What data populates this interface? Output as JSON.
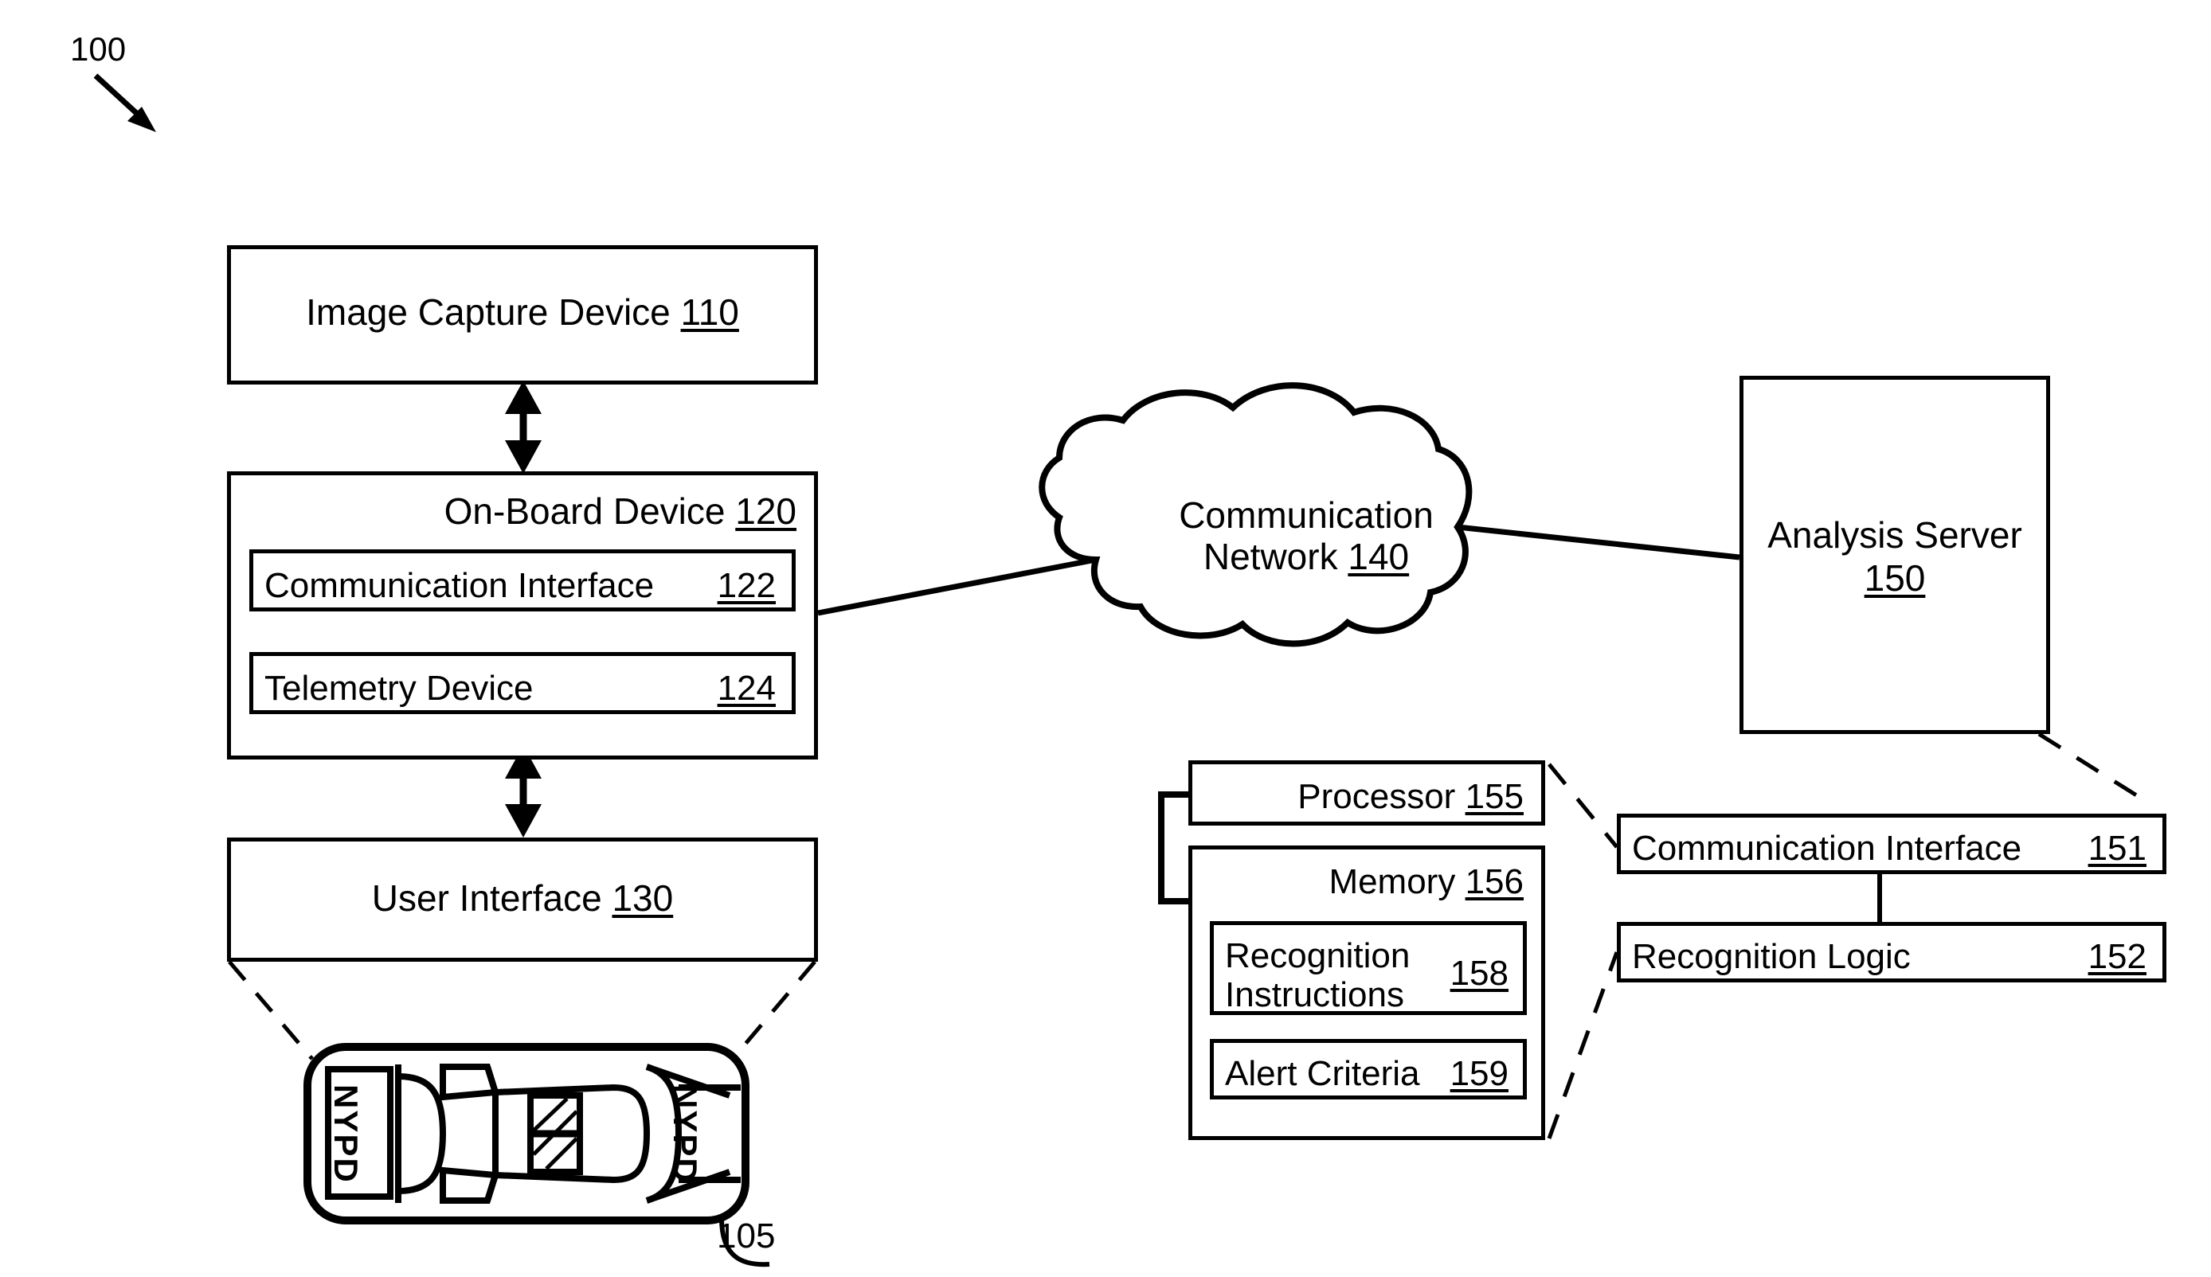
{
  "figure": {
    "number": "100",
    "vehicle_ref": "105"
  },
  "blocks": {
    "image_capture_device": {
      "label": "Image Capture Device",
      "ref": "110"
    },
    "on_board_device": {
      "label": "On-Board Device",
      "ref": "120"
    },
    "communication_interface_vehicle": {
      "label": "Communication Interface",
      "ref": "122"
    },
    "telemetry_device": {
      "label": "Telemetry Device",
      "ref": "124"
    },
    "user_interface": {
      "label": "User Interface",
      "ref": "130"
    },
    "communication_network": {
      "label_line1": "Communication",
      "label_line2": "Network",
      "ref": "140"
    },
    "analysis_server": {
      "label": "Analysis Server",
      "ref": "150"
    },
    "communication_interface_server": {
      "label": "Communication Interface",
      "ref": "151"
    },
    "recognition_logic": {
      "label": "Recognition Logic",
      "ref": "152"
    },
    "processor": {
      "label": "Processor",
      "ref": "155"
    },
    "memory": {
      "label": "Memory",
      "ref": "156"
    },
    "recognition_instructions": {
      "label_line1": "Recognition",
      "label_line2": "Instructions",
      "ref": "158"
    },
    "alert_criteria": {
      "label": "Alert Criteria",
      "ref": "159"
    }
  },
  "vehicle": {
    "marking_left": "NYPD",
    "marking_right": "NYPD"
  },
  "colors": {
    "stroke": "#000000",
    "background": "#ffffff"
  }
}
